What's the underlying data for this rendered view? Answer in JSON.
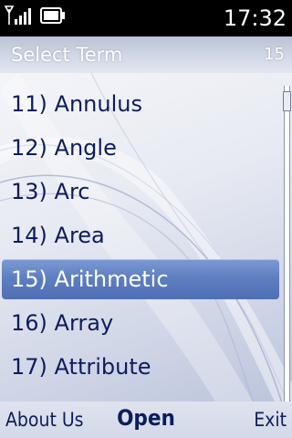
{
  "status_bar": {
    "time": "17:32",
    "signal_icon": "signal-antenna-icon",
    "battery_icon": "battery-icon"
  },
  "title_bar": {
    "title": "Select Term",
    "count": "15"
  },
  "list": {
    "items": [
      {
        "label": "11) Annulus"
      },
      {
        "label": "12) Angle"
      },
      {
        "label": "13) Arc"
      },
      {
        "label": "14) Area"
      },
      {
        "label": "15) Arithmetic"
      },
      {
        "label": "16) Array"
      },
      {
        "label": "17) Attribute"
      }
    ],
    "selected_index": 4
  },
  "softkeys": {
    "left": "About Us",
    "center": "Open",
    "right": "Exit"
  },
  "colors": {
    "text": "#0c1d5e",
    "selection": "#5f7fc2",
    "status_bar": "#000000"
  }
}
